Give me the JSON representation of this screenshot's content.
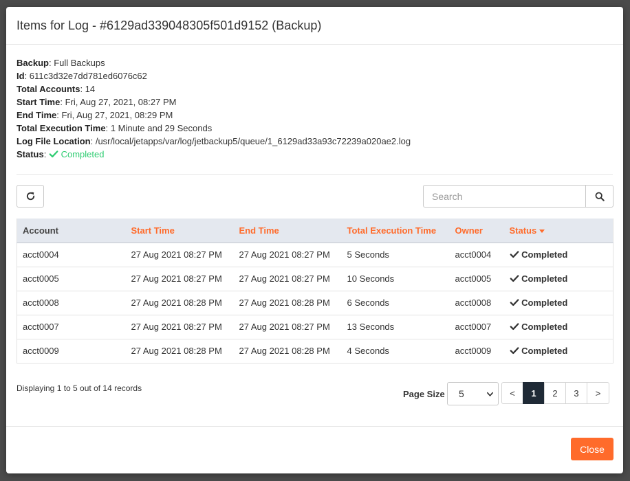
{
  "modal": {
    "title": "Items for Log - #6129ad339048305f501d9152 (Backup)"
  },
  "info": {
    "backup_label": "Backup",
    "backup_value": ": Full Backups",
    "id_label": "Id",
    "id_value": ": 611c3d32e7dd781ed6076c62",
    "total_accounts_label": "Total Accounts",
    "total_accounts_value": ": 14",
    "start_time_label": "Start Time",
    "start_time_value": ": Fri, Aug 27, 2021, 08:27 PM",
    "end_time_label": "End Time",
    "end_time_value": ": Fri, Aug 27, 2021, 08:29 PM",
    "exec_label": "Total Execution Time",
    "exec_value": ": 1 Minute and 29 Seconds",
    "log_label": "Log File Location",
    "log_value": ": /usr/local/jetapps/var/log/jetbackup5/queue/1_6129ad33a93c72239a020ae2.log",
    "status_label": "Status",
    "status_value": "Completed"
  },
  "toolbar": {
    "search_placeholder": "Search"
  },
  "table": {
    "headers": [
      "Account",
      "Start Time",
      "End Time",
      "Total Execution Time",
      "Owner",
      "Status"
    ],
    "rows": [
      [
        "acct0004",
        "27 Aug 2021 08:27 PM",
        "27 Aug 2021 08:27 PM",
        "5 Seconds",
        "acct0004",
        "Completed"
      ],
      [
        "acct0005",
        "27 Aug 2021 08:27 PM",
        "27 Aug 2021 08:27 PM",
        "10 Seconds",
        "acct0005",
        "Completed"
      ],
      [
        "acct0008",
        "27 Aug 2021 08:28 PM",
        "27 Aug 2021 08:28 PM",
        "6 Seconds",
        "acct0008",
        "Completed"
      ],
      [
        "acct0007",
        "27 Aug 2021 08:27 PM",
        "27 Aug 2021 08:27 PM",
        "13 Seconds",
        "acct0007",
        "Completed"
      ],
      [
        "acct0009",
        "27 Aug 2021 08:28 PM",
        "27 Aug 2021 08:28 PM",
        "4 Seconds",
        "acct0009",
        "Completed"
      ]
    ]
  },
  "footer": {
    "records_text": "Displaying 1 to 5 out of 14 records",
    "page_size_label": "Page Size",
    "page_size_value": "5",
    "pages": [
      "<",
      "1",
      "2",
      "3",
      ">"
    ],
    "active_page": "1",
    "close_label": "Close"
  },
  "colors": {
    "accent": "#ff6b2b",
    "success": "#2ecc71",
    "active_page": "#1f2a36"
  }
}
